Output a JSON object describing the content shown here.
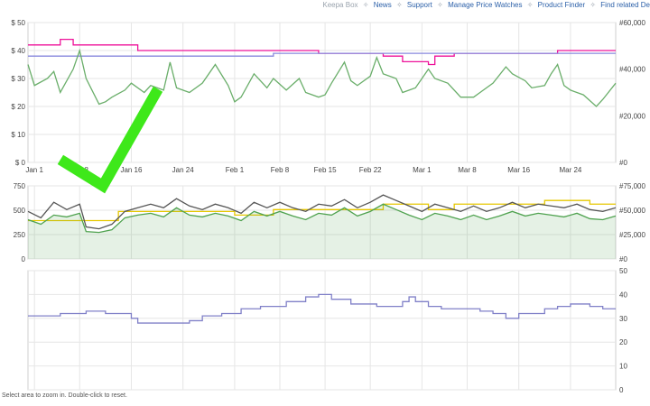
{
  "nav": {
    "brand": "Keepa Box",
    "links": [
      "News",
      "Support",
      "Manage Price Watches",
      "Product Finder",
      "Find related De"
    ]
  },
  "footer_hint": "Select area to zoom in. Double-click to reset.",
  "colors": {
    "amazon": "#ee1199",
    "new_3p": "#8888dd",
    "used": "#4fa24f",
    "sales_rank": "#6aae6a",
    "offer_count": "#e6c800",
    "rating": "#8080c8",
    "grid": "#e6e6e6",
    "checkmark": "#3ee81a"
  },
  "annotation": {
    "type": "checkmark",
    "color": "#3ee81a"
  },
  "chart_data": [
    {
      "type": "line",
      "panel": "price",
      "x_ticks": [
        "Jan 1",
        "Jan 8",
        "Jan 16",
        "Jan 24",
        "Feb 1",
        "Feb 8",
        "Feb 15",
        "Feb 22",
        "Mar 1",
        "Mar 8",
        "Mar 16",
        "Mar 24"
      ],
      "x_tick_days": [
        1,
        8,
        16,
        24,
        32,
        39,
        46,
        53,
        61,
        68,
        76,
        84
      ],
      "x_range_days": [
        0,
        91
      ],
      "y_ticks": [
        "$ 0",
        "$ 10",
        "$ 20",
        "$ 30",
        "$ 40",
        "$ 50"
      ],
      "ylim": [
        0,
        50
      ],
      "y2_ticks": [
        "#0",
        "#20,000",
        "#40,000",
        "#60,000"
      ],
      "y2lim": [
        0,
        60000
      ],
      "series": [
        {
          "color": "#ee1199",
          "points": [
            [
              0,
              42
            ],
            [
              5,
              42
            ],
            [
              5,
              44
            ],
            [
              7,
              44
            ],
            [
              7,
              42
            ],
            [
              17,
              42
            ],
            [
              17,
              40
            ],
            [
              45,
              40
            ],
            [
              45,
              39
            ],
            [
              55,
              39
            ],
            [
              55,
              38
            ],
            [
              58,
              38
            ],
            [
              58,
              36
            ],
            [
              62,
              36
            ],
            [
              62,
              35
            ],
            [
              63,
              35
            ],
            [
              63,
              38
            ],
            [
              66,
              38
            ],
            [
              66,
              39
            ],
            [
              82,
              39
            ],
            [
              82,
              40
            ],
            [
              91,
              40
            ]
          ]
        },
        {
          "color": "#8888dd",
          "points": [
            [
              0,
              38
            ],
            [
              38,
              38
            ],
            [
              38,
              39
            ],
            [
              91,
              39
            ]
          ]
        },
        {
          "color": "#6aae6a",
          "axis": "right",
          "points": [
            [
              0,
              42000
            ],
            [
              1,
              33000
            ],
            [
              3,
              36000
            ],
            [
              4,
              39000
            ],
            [
              5,
              30000
            ],
            [
              7,
              40000
            ],
            [
              8,
              48000
            ],
            [
              9,
              36000
            ],
            [
              11,
              25000
            ],
            [
              12,
              26000
            ],
            [
              13,
              28000
            ],
            [
              15,
              31000
            ],
            [
              16,
              34000
            ],
            [
              18,
              30000
            ],
            [
              19,
              33000
            ],
            [
              21,
              31000
            ],
            [
              22,
              43000
            ],
            [
              23,
              32000
            ],
            [
              25,
              30000
            ],
            [
              27,
              34000
            ],
            [
              29,
              42000
            ],
            [
              31,
              33000
            ],
            [
              32,
              26000
            ],
            [
              33,
              28000
            ],
            [
              35,
              38000
            ],
            [
              37,
              32000
            ],
            [
              38,
              36000
            ],
            [
              40,
              31000
            ],
            [
              42,
              36000
            ],
            [
              43,
              30000
            ],
            [
              45,
              28000
            ],
            [
              46,
              29000
            ],
            [
              47,
              34000
            ],
            [
              49,
              43000
            ],
            [
              50,
              35000
            ],
            [
              51,
              33000
            ],
            [
              53,
              37000
            ],
            [
              54,
              45000
            ],
            [
              55,
              38000
            ],
            [
              57,
              36000
            ],
            [
              58,
              30000
            ],
            [
              60,
              32000
            ],
            [
              62,
              40000
            ],
            [
              63,
              36000
            ],
            [
              65,
              34000
            ],
            [
              67,
              28000
            ],
            [
              69,
              28000
            ],
            [
              70,
              30000
            ],
            [
              72,
              34000
            ],
            [
              74,
              41000
            ],
            [
              75,
              38000
            ],
            [
              77,
              35000
            ],
            [
              78,
              32000
            ],
            [
              80,
              33000
            ],
            [
              81,
              38000
            ],
            [
              82,
              42000
            ],
            [
              83,
              33000
            ],
            [
              84,
              31000
            ],
            [
              86,
              29000
            ],
            [
              88,
              24000
            ],
            [
              89,
              27000
            ],
            [
              91,
              34000
            ]
          ]
        }
      ]
    },
    {
      "type": "area",
      "panel": "offers",
      "x_range_days": [
        0,
        91
      ],
      "y_ticks": [
        "0",
        "250",
        "500",
        "750"
      ],
      "ylim": [
        0,
        800
      ],
      "y2_ticks": [
        "#0",
        "#25,000",
        "#50,000",
        "#75,000"
      ],
      "y2lim": [
        0,
        80000
      ],
      "series": [
        {
          "color": "#e6c800",
          "points": [
            [
              0,
              420
            ],
            [
              14,
              420
            ],
            [
              14,
              520
            ],
            [
              32,
              520
            ],
            [
              32,
              480
            ],
            [
              38,
              480
            ],
            [
              38,
              540
            ],
            [
              55,
              540
            ],
            [
              55,
              600
            ],
            [
              62,
              600
            ],
            [
              62,
              540
            ],
            [
              66,
              540
            ],
            [
              66,
              600
            ],
            [
              80,
              600
            ],
            [
              80,
              640
            ],
            [
              87,
              640
            ],
            [
              87,
              600
            ],
            [
              91,
              600
            ]
          ]
        },
        {
          "color": "#555555",
          "points": [
            [
              0,
              520
            ],
            [
              2,
              450
            ],
            [
              4,
              620
            ],
            [
              6,
              540
            ],
            [
              8,
              600
            ],
            [
              9,
              350
            ],
            [
              11,
              330
            ],
            [
              13,
              380
            ],
            [
              15,
              520
            ],
            [
              17,
              560
            ],
            [
              19,
              600
            ],
            [
              21,
              560
            ],
            [
              23,
              660
            ],
            [
              25,
              580
            ],
            [
              27,
              540
            ],
            [
              29,
              600
            ],
            [
              31,
              560
            ],
            [
              33,
              500
            ],
            [
              35,
              620
            ],
            [
              37,
              560
            ],
            [
              39,
              620
            ],
            [
              41,
              560
            ],
            [
              43,
              520
            ],
            [
              45,
              600
            ],
            [
              47,
              580
            ],
            [
              49,
              650
            ],
            [
              51,
              560
            ],
            [
              53,
              620
            ],
            [
              55,
              700
            ],
            [
              57,
              640
            ],
            [
              59,
              580
            ],
            [
              61,
              520
            ],
            [
              63,
              600
            ],
            [
              65,
              560
            ],
            [
              67,
              520
            ],
            [
              69,
              580
            ],
            [
              71,
              520
            ],
            [
              73,
              560
            ],
            [
              75,
              620
            ],
            [
              77,
              560
            ],
            [
              79,
              600
            ],
            [
              81,
              580
            ],
            [
              83,
              560
            ],
            [
              85,
              600
            ],
            [
              87,
              540
            ],
            [
              89,
              520
            ],
            [
              91,
              560
            ]
          ]
        },
        {
          "color": "#4fa24f",
          "points": [
            [
              0,
              430
            ],
            [
              2,
              380
            ],
            [
              4,
              480
            ],
            [
              6,
              460
            ],
            [
              8,
              500
            ],
            [
              9,
              300
            ],
            [
              11,
              290
            ],
            [
              13,
              320
            ],
            [
              15,
              450
            ],
            [
              17,
              480
            ],
            [
              19,
              500
            ],
            [
              21,
              460
            ],
            [
              23,
              560
            ],
            [
              25,
              480
            ],
            [
              27,
              460
            ],
            [
              29,
              500
            ],
            [
              31,
              470
            ],
            [
              33,
              420
            ],
            [
              35,
              520
            ],
            [
              37,
              470
            ],
            [
              39,
              520
            ],
            [
              41,
              470
            ],
            [
              43,
              430
            ],
            [
              45,
              500
            ],
            [
              47,
              480
            ],
            [
              49,
              560
            ],
            [
              51,
              470
            ],
            [
              53,
              520
            ],
            [
              55,
              600
            ],
            [
              57,
              540
            ],
            [
              59,
              480
            ],
            [
              61,
              430
            ],
            [
              63,
              500
            ],
            [
              65,
              470
            ],
            [
              67,
              430
            ],
            [
              69,
              480
            ],
            [
              71,
              430
            ],
            [
              73,
              470
            ],
            [
              75,
              520
            ],
            [
              77,
              470
            ],
            [
              79,
              500
            ],
            [
              81,
              480
            ],
            [
              83,
              460
            ],
            [
              85,
              500
            ],
            [
              87,
              440
            ],
            [
              89,
              430
            ],
            [
              91,
              470
            ]
          ]
        }
      ]
    },
    {
      "type": "line",
      "panel": "rating",
      "x_range_days": [
        0,
        91
      ],
      "y_ticks": [
        "0",
        "10",
        "20",
        "30",
        "40",
        "50"
      ],
      "ylim": [
        0,
        50
      ],
      "series": [
        {
          "color": "#8080c8",
          "points": [
            [
              0,
              31
            ],
            [
              5,
              31
            ],
            [
              5,
              32
            ],
            [
              9,
              32
            ],
            [
              9,
              33
            ],
            [
              12,
              33
            ],
            [
              12,
              32
            ],
            [
              16,
              32
            ],
            [
              16,
              30
            ],
            [
              17,
              30
            ],
            [
              17,
              28
            ],
            [
              25,
              28
            ],
            [
              25,
              29
            ],
            [
              27,
              29
            ],
            [
              27,
              31
            ],
            [
              30,
              31
            ],
            [
              30,
              32
            ],
            [
              33,
              32
            ],
            [
              33,
              34
            ],
            [
              36,
              34
            ],
            [
              36,
              35
            ],
            [
              40,
              35
            ],
            [
              40,
              37
            ],
            [
              43,
              37
            ],
            [
              43,
              39
            ],
            [
              45,
              39
            ],
            [
              45,
              40
            ],
            [
              47,
              40
            ],
            [
              47,
              38
            ],
            [
              50,
              38
            ],
            [
              50,
              36
            ],
            [
              54,
              36
            ],
            [
              54,
              35
            ],
            [
              58,
              35
            ],
            [
              58,
              37
            ],
            [
              59,
              37
            ],
            [
              59,
              39
            ],
            [
              60,
              39
            ],
            [
              60,
              37
            ],
            [
              62,
              37
            ],
            [
              62,
              35
            ],
            [
              64,
              35
            ],
            [
              64,
              34
            ],
            [
              70,
              34
            ],
            [
              70,
              33
            ],
            [
              72,
              33
            ],
            [
              72,
              32
            ],
            [
              74,
              32
            ],
            [
              74,
              30
            ],
            [
              76,
              30
            ],
            [
              76,
              32
            ],
            [
              80,
              32
            ],
            [
              80,
              34
            ],
            [
              82,
              34
            ],
            [
              82,
              35
            ],
            [
              84,
              35
            ],
            [
              84,
              36
            ],
            [
              87,
              36
            ],
            [
              87,
              35
            ],
            [
              89,
              35
            ],
            [
              89,
              34
            ],
            [
              91,
              34
            ]
          ]
        }
      ]
    }
  ]
}
